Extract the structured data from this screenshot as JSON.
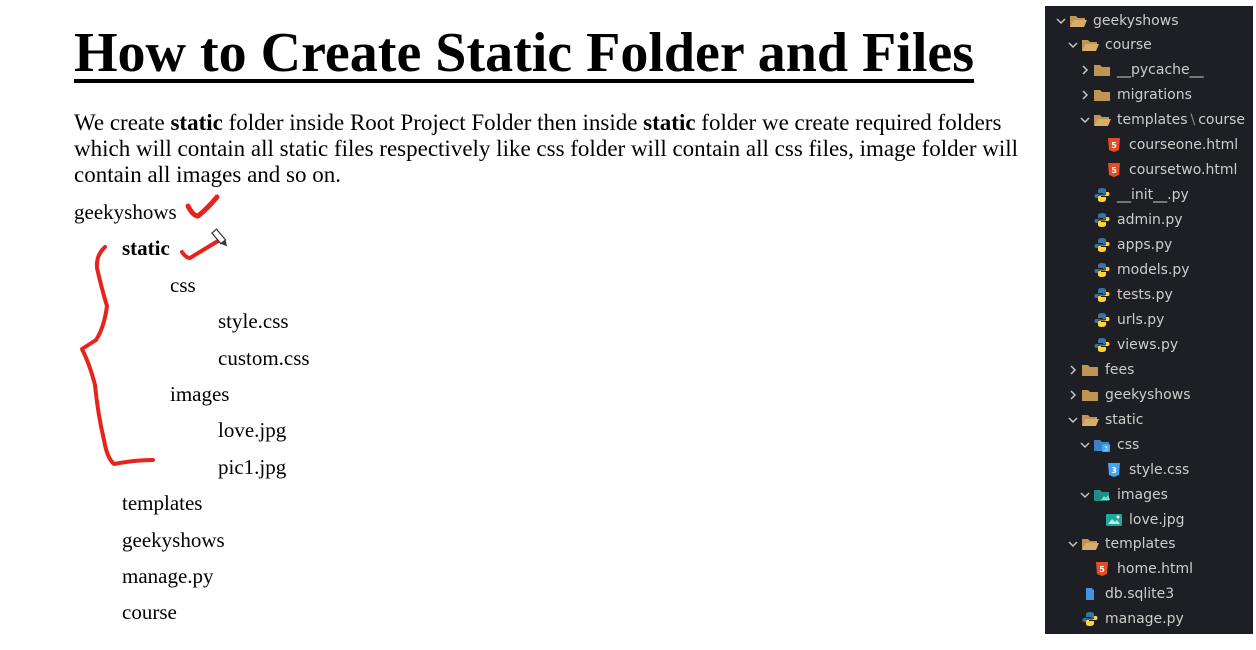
{
  "slide": {
    "title": "How to Create Static Folder and Files",
    "description": {
      "p1": "We create ",
      "b1": "static",
      "p2": " folder inside Root Project Folder then inside ",
      "b2": "static",
      "p3": " folder we create required folders which will contain all static files respectively like css folder will contain all css files, image folder will contain all images and so on."
    },
    "tree": [
      {
        "text": "geekyshows",
        "level": 0,
        "bold": false
      },
      {
        "text": "static",
        "level": 1,
        "bold": true
      },
      {
        "text": "css",
        "level": 2,
        "bold": false
      },
      {
        "text": "style.css",
        "level": 3,
        "bold": false
      },
      {
        "text": "custom.css",
        "level": 3,
        "bold": false
      },
      {
        "text": "images",
        "level": 2,
        "bold": false
      },
      {
        "text": "love.jpg",
        "level": 3,
        "bold": false
      },
      {
        "text": "pic1.jpg",
        "level": 3,
        "bold": false
      },
      {
        "text": "templates",
        "level": 1,
        "bold": false
      },
      {
        "text": "geekyshows",
        "level": 1,
        "bold": false
      },
      {
        "text": "manage.py",
        "level": 1,
        "bold": false
      },
      {
        "text": "course",
        "level": 1,
        "bold": false
      }
    ],
    "annotation_color": "#e8231d"
  },
  "explorer": {
    "items": [
      {
        "label": "geekyshows",
        "depth": 0,
        "chevron": "down",
        "icon": "folder-open-icon"
      },
      {
        "label": "course",
        "depth": 1,
        "chevron": "down",
        "icon": "folder-open-icon"
      },
      {
        "label": "__pycache__",
        "depth": 2,
        "chevron": "right",
        "icon": "folder-icon"
      },
      {
        "label": "migrations",
        "depth": 2,
        "chevron": "right",
        "icon": "folder-icon"
      },
      {
        "label": "templates",
        "suffix": "course",
        "depth": 2,
        "chevron": "down",
        "icon": "folder-open-icon"
      },
      {
        "label": "courseone.html",
        "depth": 3,
        "chevron": "none",
        "icon": "html-icon"
      },
      {
        "label": "coursetwo.html",
        "depth": 3,
        "chevron": "none",
        "icon": "html-icon"
      },
      {
        "label": "__init__.py",
        "depth": 2,
        "chevron": "none",
        "icon": "python-icon"
      },
      {
        "label": "admin.py",
        "depth": 2,
        "chevron": "none",
        "icon": "python-icon"
      },
      {
        "label": "apps.py",
        "depth": 2,
        "chevron": "none",
        "icon": "python-icon"
      },
      {
        "label": "models.py",
        "depth": 2,
        "chevron": "none",
        "icon": "python-icon"
      },
      {
        "label": "tests.py",
        "depth": 2,
        "chevron": "none",
        "icon": "python-icon"
      },
      {
        "label": "urls.py",
        "depth": 2,
        "chevron": "none",
        "icon": "python-icon"
      },
      {
        "label": "views.py",
        "depth": 2,
        "chevron": "none",
        "icon": "python-icon"
      },
      {
        "label": "fees",
        "depth": 1,
        "chevron": "right",
        "icon": "folder-icon"
      },
      {
        "label": "geekyshows",
        "depth": 1,
        "chevron": "right",
        "icon": "folder-icon"
      },
      {
        "label": "static",
        "depth": 1,
        "chevron": "down",
        "icon": "folder-open-icon"
      },
      {
        "label": "css",
        "depth": 2,
        "chevron": "down",
        "icon": "css-folder-icon"
      },
      {
        "label": "style.css",
        "depth": 3,
        "chevron": "none",
        "icon": "css-icon"
      },
      {
        "label": "images",
        "depth": 2,
        "chevron": "down",
        "icon": "images-folder-icon"
      },
      {
        "label": "love.jpg",
        "depth": 3,
        "chevron": "none",
        "icon": "image-icon"
      },
      {
        "label": "templates",
        "depth": 1,
        "chevron": "down",
        "icon": "folder-open-icon"
      },
      {
        "label": "home.html",
        "depth": 2,
        "chevron": "none",
        "icon": "html-icon"
      },
      {
        "label": "db.sqlite3",
        "depth": 1,
        "chevron": "none",
        "icon": "database-icon"
      },
      {
        "label": "manage.py",
        "depth": 1,
        "chevron": "none",
        "icon": "python-icon"
      }
    ]
  },
  "colors": {
    "explorer_bg": "#1e1f24",
    "explorer_text": "#cccccc",
    "folder": "#c09553",
    "html": "#e44d26",
    "css": "#42a5f5",
    "python_blue": "#3572a5",
    "python_yellow": "#ffd43b",
    "image": "#26a69a"
  }
}
